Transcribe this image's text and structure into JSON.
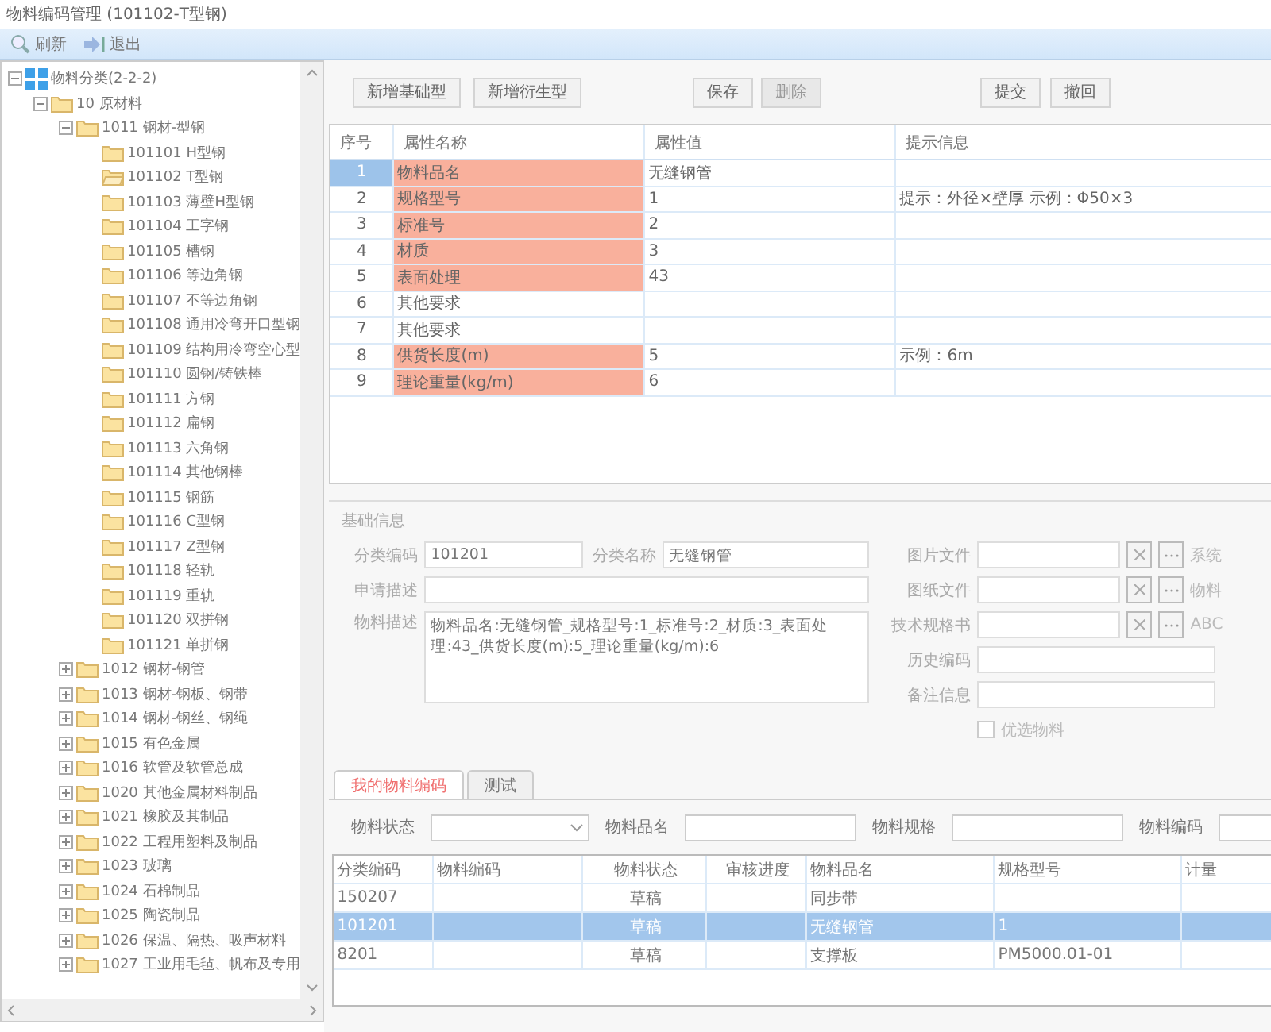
{
  "window": {
    "title": "物料编码管理  (101102-T型钢)"
  },
  "toolbar": [
    {
      "label": "刷新",
      "kind": "refresh"
    },
    {
      "label": "退出",
      "kind": "exit"
    }
  ],
  "tree": [
    {
      "label": "物料分类(2-2-2)",
      "kind": "root",
      "expanded": true,
      "children": [
        {
          "label": "10 原材料",
          "kind": "folder",
          "expanded": true,
          "children": [
            {
              "label": "1011 钢材-型钢",
              "kind": "folder",
              "expanded": true,
              "children": [
                {
                  "label": "101101 H型钢",
                  "kind": "folder"
                },
                {
                  "label": "101102 T型钢",
                  "kind": "folder-open"
                },
                {
                  "label": "101103 薄壁H型钢",
                  "kind": "folder"
                },
                {
                  "label": "101104 工字钢",
                  "kind": "folder"
                },
                {
                  "label": "101105 槽钢",
                  "kind": "folder"
                },
                {
                  "label": "101106 等边角钢",
                  "kind": "folder"
                },
                {
                  "label": "101107 不等边角钢",
                  "kind": "folder"
                },
                {
                  "label": "101108 通用冷弯开口型钢",
                  "kind": "folder"
                },
                {
                  "label": "101109 结构用冷弯空心型",
                  "kind": "folder"
                },
                {
                  "label": "101110 圆钢/铸铁棒",
                  "kind": "folder"
                },
                {
                  "label": "101111 方钢",
                  "kind": "folder"
                },
                {
                  "label": "101112 扁钢",
                  "kind": "folder"
                },
                {
                  "label": "101113 六角钢",
                  "kind": "folder"
                },
                {
                  "label": "101114 其他钢棒",
                  "kind": "folder"
                },
                {
                  "label": "101115 钢筋",
                  "kind": "folder"
                },
                {
                  "label": "101116 C型钢",
                  "kind": "folder"
                },
                {
                  "label": "101117 Z型钢",
                  "kind": "folder"
                },
                {
                  "label": "101118 轻轨",
                  "kind": "folder"
                },
                {
                  "label": "101119 重轨",
                  "kind": "folder"
                },
                {
                  "label": "101120 双拼钢",
                  "kind": "folder"
                },
                {
                  "label": "101121 单拼钢",
                  "kind": "folder"
                }
              ]
            },
            {
              "label": "1012 钢材-钢管",
              "kind": "folder",
              "expanded": false
            },
            {
              "label": "1013 钢材-钢板、钢带",
              "kind": "folder",
              "expanded": false
            },
            {
              "label": "1014 钢材-钢丝、钢绳",
              "kind": "folder",
              "expanded": false
            },
            {
              "label": "1015 有色金属",
              "kind": "folder",
              "expanded": false
            },
            {
              "label": "1016 软管及软管总成",
              "kind": "folder",
              "expanded": false
            },
            {
              "label": "1020 其他金属材料制品",
              "kind": "folder",
              "expanded": false
            },
            {
              "label": "1021 橡胶及其制品",
              "kind": "folder",
              "expanded": false
            },
            {
              "label": "1022 工程用塑料及制品",
              "kind": "folder",
              "expanded": false
            },
            {
              "label": "1023 玻璃",
              "kind": "folder",
              "expanded": false
            },
            {
              "label": "1024 石棉制品",
              "kind": "folder",
              "expanded": false
            },
            {
              "label": "1025 陶瓷制品",
              "kind": "folder",
              "expanded": false
            },
            {
              "label": "1026 保温、隔热、吸声材料",
              "kind": "folder",
              "expanded": false
            },
            {
              "label": "1027 工业用毛毡、帆布及专用",
              "kind": "folder",
              "expanded": false
            }
          ]
        }
      ]
    }
  ],
  "actions": [
    {
      "label": "新增基础型",
      "disabled": false
    },
    {
      "label": "新增衍生型",
      "disabled": false
    },
    {
      "label": "保存",
      "disabled": false
    },
    {
      "label": "删除",
      "disabled": true
    },
    {
      "label": "提交",
      "disabled": false
    },
    {
      "label": "撤回",
      "disabled": false
    }
  ],
  "attributes": {
    "columns": [
      "序号",
      "属性名称",
      "属性值",
      "提示信息"
    ],
    "rows": [
      {
        "index": "1",
        "name": "物料品名",
        "value": "无缝钢管",
        "hint": "",
        "required": true,
        "selected": true
      },
      {
        "index": "2",
        "name": "规格型号",
        "value": "1",
        "hint": "提示：外径×壁厚    示例：Φ50×3",
        "required": true,
        "selected": false
      },
      {
        "index": "3",
        "name": "标准号",
        "value": "2",
        "hint": "",
        "required": true,
        "selected": false
      },
      {
        "index": "4",
        "name": "材质",
        "value": "3",
        "hint": "",
        "required": true,
        "selected": false
      },
      {
        "index": "5",
        "name": "表面处理",
        "value": "43",
        "hint": "",
        "required": true,
        "selected": false
      },
      {
        "index": "6",
        "name": "其他要求",
        "value": "",
        "hint": "",
        "required": false,
        "selected": false
      },
      {
        "index": "7",
        "name": "其他要求",
        "value": "",
        "hint": "",
        "required": false,
        "selected": false
      },
      {
        "index": "8",
        "name": "供货长度(m)",
        "value": "5",
        "hint": "示例：6m",
        "required": true,
        "selected": false
      },
      {
        "index": "9",
        "name": "理论重量(kg/m)",
        "value": "6",
        "hint": "",
        "required": true,
        "selected": false
      }
    ]
  },
  "basic_info": {
    "title": "基础信息",
    "left": [
      {
        "label": "分类编码",
        "value": "101201",
        "label2": "分类名称",
        "value2": "无缝钢管"
      },
      {
        "label": "申请描述"
      }
    ],
    "description": {
      "label": "物料描述",
      "value": "物料品名:无缝钢管_规格型号:1_标准号:2_材质:3_表面处理:43_供货长度(m):5_理论重量(kg/m):6"
    },
    "right": [
      {
        "label": "图片文件",
        "kind": "file",
        "extra": "系统"
      },
      {
        "label": "图纸文件",
        "kind": "file",
        "extra": "物料"
      },
      {
        "label": "技术规格书",
        "kind": "file",
        "extra": "ABC"
      },
      {
        "label": "历史编码",
        "kind": "text"
      },
      {
        "label": "备注信息",
        "kind": "text"
      }
    ],
    "preferred": {
      "label": "优选物料",
      "checked": false
    }
  },
  "tabs": [
    {
      "label": "我的物料编码",
      "selected": true
    },
    {
      "label": "测试",
      "selected": false
    }
  ],
  "filters": [
    {
      "label": "物料状态",
      "kind": "select"
    },
    {
      "label": "物料品名",
      "kind": "text"
    },
    {
      "label": "物料规格",
      "kind": "text"
    },
    {
      "label": "物料编码",
      "kind": "text"
    }
  ],
  "materials": {
    "columns": [
      "分类编码",
      "物料编码",
      "物料状态",
      "审核进度",
      "物料品名",
      "规格型号",
      "计量"
    ],
    "rows": [
      {
        "cells": [
          "150207",
          "",
          "草稿",
          "",
          "同步带",
          ""
        ],
        "selected": false
      },
      {
        "cells": [
          "101201",
          "",
          "草稿",
          "",
          "无缝钢管",
          "1"
        ],
        "selected": true
      },
      {
        "cells": [
          "8201",
          "",
          "草稿",
          "",
          "支撑板",
          "PM5000.01-01"
        ],
        "selected": false
      }
    ]
  }
}
